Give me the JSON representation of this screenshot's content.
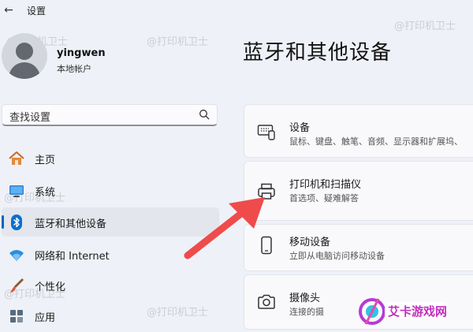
{
  "app": {
    "title": "设置",
    "back_icon": "back-arrow-icon"
  },
  "user": {
    "name": "yingwen",
    "account_type": "本地帐户"
  },
  "search": {
    "placeholder": "查找设置"
  },
  "nav": {
    "items": [
      {
        "label": "主页",
        "icon": "home-icon",
        "active": false
      },
      {
        "label": "系统",
        "icon": "system-monitor-icon",
        "active": false
      },
      {
        "label": "蓝牙和其他设备",
        "icon": "bluetooth-icon",
        "active": true
      },
      {
        "label": "网络和 Internet",
        "icon": "wifi-icon",
        "active": false
      },
      {
        "label": "个性化",
        "icon": "paint-brush-icon",
        "active": false
      },
      {
        "label": "应用",
        "icon": "apps-icon",
        "active": false
      }
    ]
  },
  "main": {
    "title": "蓝牙和其他设备",
    "cards": [
      {
        "title": "设备",
        "subtitle": "鼠标、键盘、触笔、音频、显示器和扩展坞、",
        "icon": "devices-icon"
      },
      {
        "title": "打印机和扫描仪",
        "subtitle": "首选项、疑难解答",
        "icon": "printer-icon"
      },
      {
        "title": "移动设备",
        "subtitle": "立即从电脑访问移动设备",
        "icon": "phone-icon"
      },
      {
        "title": "摄像头",
        "subtitle": "连接的摄",
        "icon": "camera-icon"
      }
    ]
  },
  "watermark": {
    "text": "@打印机卫士"
  },
  "logo": {
    "text": "艾卡游戏网"
  },
  "colors": {
    "accent": "#0067c0",
    "annotation_arrow": "#ef4b4b",
    "background": "#eef1f7"
  }
}
